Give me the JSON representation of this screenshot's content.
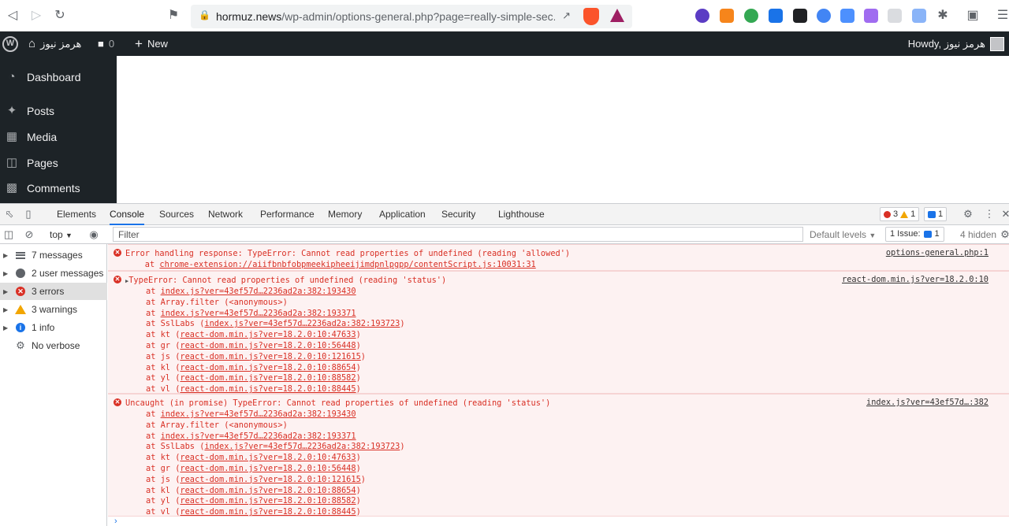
{
  "browser": {
    "url_host": "hormuz.news",
    "url_path": "/wp-admin/options-general.php?page=really-simple-sec..."
  },
  "wp_bar": {
    "site_name": "هرمز نیوز",
    "comments_count": "0",
    "new_label": "New",
    "howdy": "Howdy, هرمز نیوز"
  },
  "sidebar": {
    "items": [
      {
        "label": "Dashboard",
        "icon": "dashboard-icon"
      },
      {
        "label": "Posts",
        "icon": "pin-icon"
      },
      {
        "label": "Media",
        "icon": "media-icon"
      },
      {
        "label": "Pages",
        "icon": "pages-icon"
      },
      {
        "label": "Comments",
        "icon": "comment-icon"
      }
    ]
  },
  "devtools": {
    "tabs": [
      "Elements",
      "Console",
      "Sources",
      "Network",
      "Performance",
      "Memory",
      "Application",
      "Security",
      "Lighthouse"
    ],
    "active_tab": "Console",
    "error_count": "3",
    "warning_count": "1",
    "issue_count": "1",
    "context": "top",
    "filter_placeholder": "Filter",
    "levels": "Default levels",
    "issue_label": "1 Issue:",
    "issue_num": "1",
    "hidden": "4 hidden"
  },
  "console_sidebar": [
    {
      "label": "7 messages",
      "icon": "list-icon"
    },
    {
      "label": "2 user messages",
      "icon": "user-icon"
    },
    {
      "label": "3 errors",
      "icon": "error-icon"
    },
    {
      "label": "3 warnings",
      "icon": "warning-icon"
    },
    {
      "label": "1 info",
      "icon": "info-icon"
    },
    {
      "label": "No verbose",
      "icon": "gear-icon"
    }
  ],
  "messages": {
    "m1": {
      "text": "Error handling response: TypeError: Cannot read properties of undefined (reading 'allowed')",
      "at_prefix": "    at ",
      "at_link": "chrome-extension://aiifbnbfobpmeekipheeijimdpnlpgpp/contentScript.js:10031:31",
      "source": "options-general.php:1"
    },
    "m2": {
      "text": "TypeError: Cannot read properties of undefined (reading 'status')",
      "source": "react-dom.min.js?ver=18.2.0:10"
    },
    "m3": {
      "text": "Uncaught (in promise) TypeError: Cannot read properties of undefined (reading 'status')",
      "source": "index.js?ver=43ef57d…:382"
    },
    "stack": [
      {
        "pre": "at ",
        "fn": "",
        "link": "index.js?ver=43ef57d…2236ad2a:382:193430",
        "post": ""
      },
      {
        "pre": "at ",
        "fn": "Array.filter (<anonymous>)",
        "link": "",
        "post": ""
      },
      {
        "pre": "at ",
        "fn": "",
        "link": "index.js?ver=43ef57d…2236ad2a:382:193371",
        "post": ""
      },
      {
        "pre": "at ",
        "fn": "SslLabs (",
        "link": "index.js?ver=43ef57d…2236ad2a:382:193723",
        "post": ")"
      },
      {
        "pre": "at ",
        "fn": "kt (",
        "link": "react-dom.min.js?ver=18.2.0:10:47633",
        "post": ")"
      },
      {
        "pre": "at ",
        "fn": "gr (",
        "link": "react-dom.min.js?ver=18.2.0:10:56448",
        "post": ")"
      },
      {
        "pre": "at ",
        "fn": "js (",
        "link": "react-dom.min.js?ver=18.2.0:10:121615",
        "post": ")"
      },
      {
        "pre": "at ",
        "fn": "kl (",
        "link": "react-dom.min.js?ver=18.2.0:10:88654",
        "post": ")"
      },
      {
        "pre": "at ",
        "fn": "yl (",
        "link": "react-dom.min.js?ver=18.2.0:10:88582",
        "post": ")"
      },
      {
        "pre": "at ",
        "fn": "vl (",
        "link": "react-dom.min.js?ver=18.2.0:10:88445",
        "post": ")"
      }
    ]
  },
  "colors": {
    "wp_dark": "#1d2327",
    "error_red": "#d93025",
    "error_bg": "#fdf2f2",
    "accent_blue": "#1a73e8"
  }
}
